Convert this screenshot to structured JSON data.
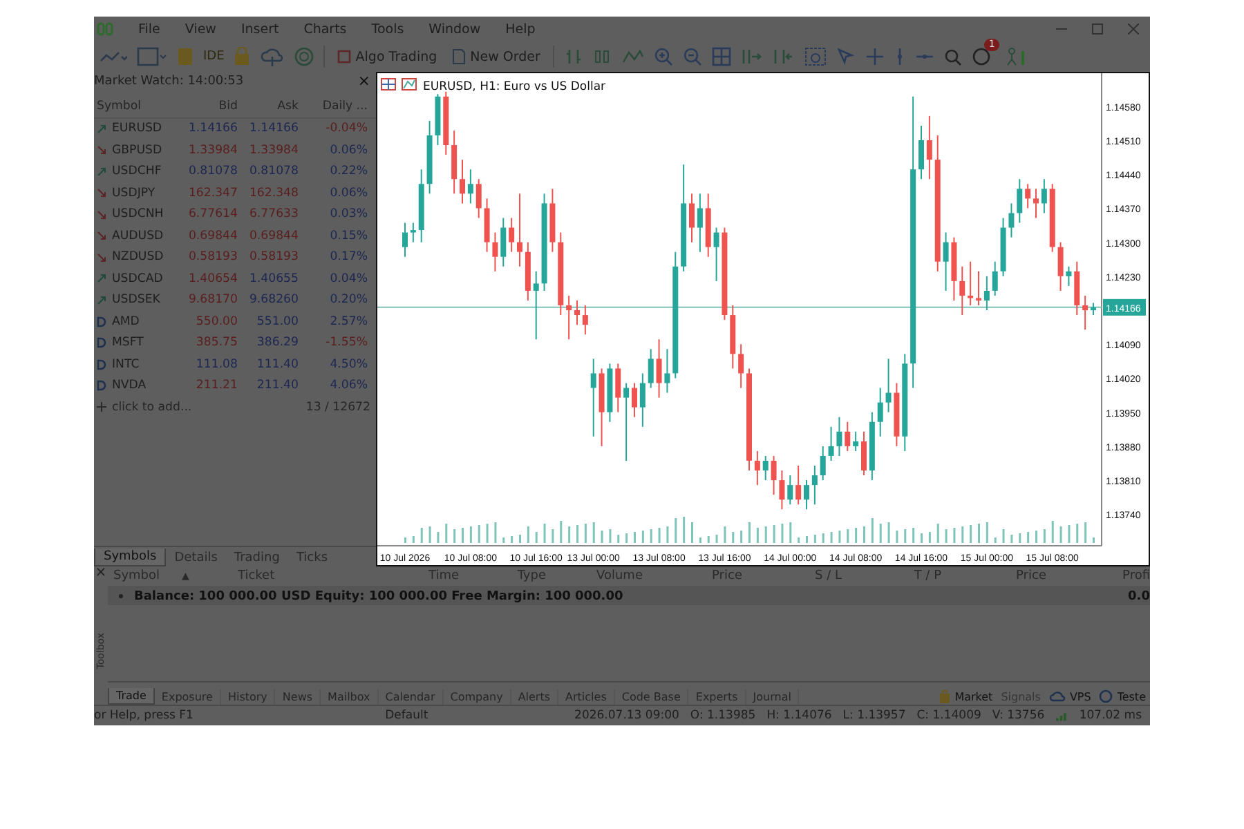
{
  "menu": [
    "File",
    "View",
    "Insert",
    "Charts",
    "Tools",
    "Window",
    "Help"
  ],
  "toolbar": {
    "ide": "IDE",
    "algo_trading": "Algo Trading",
    "new_order": "New Order",
    "badge": "1"
  },
  "market_watch": {
    "title": "Market Watch: 14:00:53",
    "close": "×",
    "columns": [
      "Symbol",
      "Bid",
      "Ask",
      "Daily ..."
    ],
    "rows": [
      {
        "symbol": "EURUSD",
        "kind": "forex",
        "rising": true,
        "bid": "1.14166",
        "ask": "1.14166",
        "daily": "-0.04%",
        "bid_up": true,
        "ask_up": true,
        "daily_up": false
      },
      {
        "symbol": "GBPUSD",
        "kind": "forex",
        "rising": false,
        "bid": "1.33984",
        "ask": "1.33984",
        "daily": "0.06%",
        "bid_up": false,
        "ask_up": false,
        "daily_up": true
      },
      {
        "symbol": "USDCHF",
        "kind": "forex",
        "rising": true,
        "bid": "0.81078",
        "ask": "0.81078",
        "daily": "0.22%",
        "bid_up": true,
        "ask_up": true,
        "daily_up": true
      },
      {
        "symbol": "USDJPY",
        "kind": "forex",
        "rising": false,
        "bid": "162.347",
        "ask": "162.348",
        "daily": "0.06%",
        "bid_up": false,
        "ask_up": false,
        "daily_up": true
      },
      {
        "symbol": "USDCNH",
        "kind": "forex",
        "rising": false,
        "bid": "6.77614",
        "ask": "6.77633",
        "daily": "0.03%",
        "bid_up": false,
        "ask_up": false,
        "daily_up": true
      },
      {
        "symbol": "AUDUSD",
        "kind": "forex",
        "rising": false,
        "bid": "0.69844",
        "ask": "0.69844",
        "daily": "0.15%",
        "bid_up": false,
        "ask_up": false,
        "daily_up": true
      },
      {
        "symbol": "NZDUSD",
        "kind": "forex",
        "rising": false,
        "bid": "0.58193",
        "ask": "0.58193",
        "daily": "0.17%",
        "bid_up": false,
        "ask_up": false,
        "daily_up": true
      },
      {
        "symbol": "USDCAD",
        "kind": "forex",
        "rising": true,
        "bid": "1.40654",
        "ask": "1.40655",
        "daily": "0.04%",
        "bid_up": false,
        "ask_up": true,
        "daily_up": true
      },
      {
        "symbol": "USDSEK",
        "kind": "forex",
        "rising": true,
        "bid": "9.68170",
        "ask": "9.68260",
        "daily": "0.20%",
        "bid_up": false,
        "ask_up": true,
        "daily_up": true
      },
      {
        "symbol": "AMD",
        "kind": "stock",
        "bid": "550.00",
        "ask": "551.00",
        "daily": "2.57%",
        "bid_up": false,
        "ask_up": true,
        "daily_up": true
      },
      {
        "symbol": "MSFT",
        "kind": "stock",
        "bid": "385.75",
        "ask": "386.29",
        "daily": "-1.55%",
        "bid_up": false,
        "ask_up": true,
        "daily_up": false
      },
      {
        "symbol": "INTC",
        "kind": "stock",
        "bid": "111.08",
        "ask": "111.40",
        "daily": "4.50%",
        "bid_up": true,
        "ask_up": true,
        "daily_up": true
      },
      {
        "symbol": "NVDA",
        "kind": "stock",
        "bid": "211.21",
        "ask": "211.40",
        "daily": "4.06%",
        "bid_up": false,
        "ask_up": true,
        "daily_up": true
      }
    ],
    "add": "click to add...",
    "count": "13 / 12672",
    "tabs": [
      {
        "label": "Symbols",
        "selected": true
      },
      {
        "label": "Details",
        "selected": false
      },
      {
        "label": "Trading",
        "selected": false
      },
      {
        "label": "Ticks",
        "selected": false
      }
    ]
  },
  "chart": {
    "title": "EURUSD, H1:  Euro vs US Dollar",
    "chart_data": {
      "type": "candlestick",
      "categories": [
        "10 Jul 2026",
        null,
        null,
        null,
        null,
        null,
        null,
        null,
        "10 Jul 08:00",
        null,
        null,
        null,
        null,
        null,
        null,
        null,
        "10 Jul 16:00",
        null,
        null,
        null,
        null,
        null,
        null,
        "13 Jul 00:00",
        null,
        null,
        null,
        null,
        null,
        null,
        null,
        "13 Jul 08:00",
        null,
        null,
        null,
        null,
        null,
        null,
        null,
        "13 Jul 16:00",
        null,
        null,
        null,
        null,
        null,
        null,
        null,
        "14 Jul 00:00",
        null,
        null,
        null,
        null,
        null,
        null,
        null,
        "14 Jul 08:00",
        null,
        null,
        null,
        null,
        null,
        null,
        null,
        "14 Jul 16:00",
        null,
        null,
        null,
        null,
        null,
        null,
        null,
        "15 Jul 00:00",
        null,
        null,
        null,
        null,
        null,
        null,
        null,
        "15 Jul 08:00",
        null,
        null,
        null,
        null,
        null
      ],
      "ylim": [
        1.13675,
        1.14648
      ],
      "ohlc": [
        [
          1.1429,
          1.1434,
          1.1427,
          1.1432
        ],
        [
          1.1432,
          1.1434,
          1.143,
          1.14325
        ],
        [
          1.14325,
          1.1445,
          1.143,
          1.1442
        ],
        [
          1.1442,
          1.1455,
          1.144,
          1.1452
        ],
        [
          1.1452,
          1.14605,
          1.145,
          1.146
        ],
        [
          1.146,
          1.1461,
          1.1448,
          1.145
        ],
        [
          1.145,
          1.1453,
          1.144,
          1.1443
        ],
        [
          1.1443,
          1.1447,
          1.1438,
          1.144
        ],
        [
          1.144,
          1.1445,
          1.1438,
          1.1442
        ],
        [
          1.1442,
          1.1443,
          1.1435,
          1.1437
        ],
        [
          1.1437,
          1.1439,
          1.1428,
          1.143
        ],
        [
          1.143,
          1.1432,
          1.1424,
          1.1427
        ],
        [
          1.1427,
          1.1435,
          1.1425,
          1.1433
        ],
        [
          1.1433,
          1.1435,
          1.1428,
          1.143
        ],
        [
          1.143,
          1.144,
          1.1425,
          1.1428
        ],
        [
          1.1428,
          1.143,
          1.1418,
          1.142
        ],
        [
          1.142,
          1.1424,
          1.141,
          1.14215
        ],
        [
          1.14215,
          1.144,
          1.142,
          1.1438
        ],
        [
          1.1438,
          1.1441,
          1.1428,
          1.143
        ],
        [
          1.143,
          1.1432,
          1.1415,
          1.1417
        ],
        [
          1.1417,
          1.1419,
          1.141,
          1.1416
        ],
        [
          1.1416,
          1.1418,
          1.1413,
          1.1415
        ],
        [
          1.1415,
          1.1417,
          1.1411,
          1.1413
        ],
        [
          1.14,
          1.1406,
          1.139,
          1.1403
        ],
        [
          1.1403,
          1.1404,
          1.1388,
          1.1395
        ],
        [
          1.1395,
          1.1405,
          1.1393,
          1.1404
        ],
        [
          1.1404,
          1.1405,
          1.1395,
          1.1398
        ],
        [
          1.1398,
          1.1401,
          1.1385,
          1.14
        ],
        [
          1.14,
          1.1401,
          1.1394,
          1.1396
        ],
        [
          1.1396,
          1.1403,
          1.1392,
          1.1401
        ],
        [
          1.1401,
          1.1408,
          1.14,
          1.1406
        ],
        [
          1.1406,
          1.141,
          1.1398,
          1.1401
        ],
        [
          1.1401,
          1.1408,
          1.1399,
          1.1403
        ],
        [
          1.1403,
          1.1428,
          1.1402,
          1.1425
        ],
        [
          1.1425,
          1.1446,
          1.1424,
          1.1438
        ],
        [
          1.1438,
          1.144,
          1.143,
          1.1433
        ],
        [
          1.1433,
          1.144,
          1.1428,
          1.1437
        ],
        [
          1.1437,
          1.144,
          1.1427,
          1.1429
        ],
        [
          1.1429,
          1.1433,
          1.1422,
          1.1432
        ],
        [
          1.1432,
          1.1433,
          1.1414,
          1.1415
        ],
        [
          1.1415,
          1.1417,
          1.1404,
          1.1407
        ],
        [
          1.1407,
          1.1409,
          1.14,
          1.1403
        ],
        [
          1.1403,
          1.1404,
          1.1383,
          1.1385
        ],
        [
          1.1385,
          1.1387,
          1.138,
          1.1383
        ],
        [
          1.1383,
          1.1386,
          1.1381,
          1.1385
        ],
        [
          1.1385,
          1.1386,
          1.1378,
          1.1381
        ],
        [
          1.1381,
          1.1383,
          1.1375,
          1.1377
        ],
        [
          1.1377,
          1.1382,
          1.1376,
          1.138
        ],
        [
          1.138,
          1.1384,
          1.1376,
          1.1377
        ],
        [
          1.1377,
          1.1381,
          1.1375,
          1.138
        ],
        [
          1.138,
          1.1384,
          1.1376,
          1.1382
        ],
        [
          1.1382,
          1.1388,
          1.1381,
          1.1386
        ],
        [
          1.1386,
          1.1392,
          1.1385,
          1.1388
        ],
        [
          1.1388,
          1.1394,
          1.1386,
          1.1391
        ],
        [
          1.1391,
          1.1393,
          1.1387,
          1.1388
        ],
        [
          1.1388,
          1.1391,
          1.1387,
          1.1389
        ],
        [
          1.1389,
          1.1391,
          1.1382,
          1.1383
        ],
        [
          1.1383,
          1.1395,
          1.1381,
          1.1393
        ],
        [
          1.1393,
          1.14,
          1.139,
          1.1397
        ],
        [
          1.1397,
          1.1406,
          1.1395,
          1.1399
        ],
        [
          1.1399,
          1.1401,
          1.1388,
          1.139
        ],
        [
          1.139,
          1.1407,
          1.1387,
          1.1405
        ],
        [
          1.1405,
          1.146,
          1.14,
          1.1445
        ],
        [
          1.1445,
          1.1454,
          1.1443,
          1.1451
        ],
        [
          1.1451,
          1.1456,
          1.1443,
          1.1447
        ],
        [
          1.1447,
          1.1452,
          1.1424,
          1.1426
        ],
        [
          1.1426,
          1.1432,
          1.142,
          1.143
        ],
        [
          1.143,
          1.1431,
          1.1418,
          1.1422
        ],
        [
          1.1422,
          1.1425,
          1.1415,
          1.1419
        ],
        [
          1.1419,
          1.1426,
          1.1417,
          1.14185
        ],
        [
          1.14185,
          1.1424,
          1.1417,
          1.1418
        ],
        [
          1.1418,
          1.1423,
          1.1416,
          1.142
        ],
        [
          1.142,
          1.1426,
          1.1419,
          1.1424
        ],
        [
          1.1424,
          1.1435,
          1.1423,
          1.1433
        ],
        [
          1.1433,
          1.1438,
          1.1431,
          1.1436
        ],
        [
          1.1436,
          1.1443,
          1.1434,
          1.1441
        ],
        [
          1.1441,
          1.1442,
          1.1437,
          1.1439
        ],
        [
          1.1439,
          1.1441,
          1.1435,
          1.1438
        ],
        [
          1.1438,
          1.1443,
          1.1436,
          1.1441
        ],
        [
          1.1441,
          1.1442,
          1.1428,
          1.1429
        ],
        [
          1.1429,
          1.143,
          1.142,
          1.1423
        ],
        [
          1.1423,
          1.1425,
          1.1421,
          1.1424
        ],
        [
          1.1424,
          1.1426,
          1.1415,
          1.1417
        ],
        [
          1.1417,
          1.1419,
          1.1412,
          1.1416
        ],
        [
          1.1416,
          1.14175,
          1.1415,
          1.14166
        ]
      ],
      "yticks": [
        {
          "value": 1.1458,
          "label": "1.14580"
        },
        {
          "value": 1.1451,
          "label": "1.14510"
        },
        {
          "value": 1.1444,
          "label": "1.14440"
        },
        {
          "value": 1.1437,
          "label": "1.14370"
        },
        {
          "value": 1.143,
          "label": "1.14300"
        },
        {
          "value": 1.1423,
          "label": "1.14230"
        },
        {
          "value": 1.1409,
          "label": "1.14090"
        },
        {
          "value": 1.1402,
          "label": "1.14020"
        },
        {
          "value": 1.1395,
          "label": "1.13950"
        },
        {
          "value": 1.1388,
          "label": "1.13880"
        },
        {
          "value": 1.1381,
          "label": "1.13810"
        },
        {
          "value": 1.1374,
          "label": "1.13740"
        }
      ],
      "orientation": "vertical",
      "ref_lines": [
        {
          "axis": "y",
          "value": 1.14166,
          "label": "1.14166"
        }
      ]
    }
  },
  "toolbox": {
    "label": "Toolbox",
    "close": "×",
    "columns": [
      "Symbol",
      "Ticket",
      "Time",
      "Type",
      "Volume",
      "Price",
      "S / L",
      "T / P",
      "Price",
      "Profi"
    ],
    "sort_mark": "▲",
    "balance": "Balance: 100 000.00 USD  Equity: 100 000.00  Free Margin: 100 000.00",
    "balance_profit": "0.0",
    "tabs": [
      {
        "label": "Trade",
        "selected": true
      },
      {
        "label": "Exposure",
        "selected": false
      },
      {
        "label": "History",
        "selected": false
      },
      {
        "label": "News",
        "selected": false
      },
      {
        "label": "Mailbox",
        "selected": false
      },
      {
        "label": "Calendar",
        "selected": false
      },
      {
        "label": "Company",
        "selected": false
      },
      {
        "label": "Alerts",
        "selected": false
      },
      {
        "label": "Articles",
        "selected": false
      },
      {
        "label": "Code Base",
        "selected": false
      },
      {
        "label": "Experts",
        "selected": false
      },
      {
        "label": "Journal",
        "selected": false
      }
    ],
    "services": [
      {
        "label": "Market",
        "kind": "bag",
        "disabled": false
      },
      {
        "label": "Signals",
        "kind": "none",
        "disabled": true
      },
      {
        "label": "VPS",
        "kind": "cloud",
        "disabled": false
      },
      {
        "label": "Teste",
        "kind": "circle",
        "disabled": false
      }
    ]
  },
  "status_bar": {
    "help": "or Help, press F1",
    "profile": "Default",
    "time": "2026.07.13 09:00",
    "open": "O: 1.13985",
    "high": "H: 1.14076",
    "low": "L: 1.13957",
    "close": "C: 1.14009",
    "volume": "V: 13756",
    "ping": "107.02 ms"
  }
}
